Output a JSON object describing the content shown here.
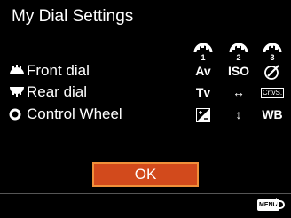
{
  "header": {
    "title": "My Dial Settings"
  },
  "dial_columns": [
    {
      "number": "1",
      "icon": "dial-1-icon"
    },
    {
      "number": "2",
      "icon": "dial-2-icon"
    },
    {
      "number": "3",
      "icon": "dial-3-icon"
    }
  ],
  "rows": [
    {
      "label": "Front dial",
      "icon": "front-dial-icon",
      "values": [
        "Av",
        "ISO",
        "creative-style-brush-icon"
      ]
    },
    {
      "label": "Rear dial",
      "icon": "rear-dial-icon",
      "values": [
        "Tv",
        "↔",
        "CrtvS."
      ]
    },
    {
      "label": "Control Wheel",
      "icon": "control-wheel-icon",
      "values": [
        "exposure-compensation-icon",
        "↕",
        "WB"
      ]
    }
  ],
  "footer": {
    "ok_label": "OK",
    "menu_badge": "MENU",
    "back_icon": "back-arrow-icon"
  },
  "colors": {
    "ok_fill": "#d24a1c",
    "ok_border": "#f0903a",
    "background": "#000000"
  }
}
